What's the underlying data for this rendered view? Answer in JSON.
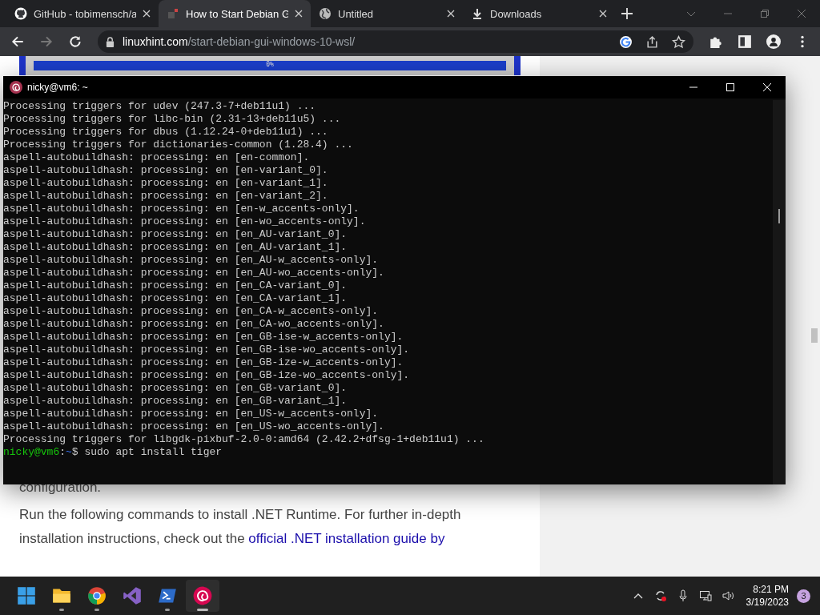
{
  "browser": {
    "tabs": [
      {
        "label": "GitHub - tobimensch/a",
        "selected": false
      },
      {
        "label": "How to Start Debian G",
        "selected": true
      },
      {
        "label": "Untitled",
        "selected": false
      },
      {
        "label": "Downloads",
        "selected": false
      }
    ],
    "address": {
      "domain": "linuxhint.com",
      "path": "/start-debian-gui-windows-10-wsl/"
    }
  },
  "page": {
    "progress_label": "0%",
    "progress": {
      "level": 0
    },
    "cut_line": "configuration.",
    "paragraph": {
      "text": "Run the following commands to install .NET Runtime. For further in-depth installation instructions, check out the ",
      "link": "official .NET installation guide by"
    }
  },
  "terminal": {
    "title": "nicky@vm6: ~",
    "lines": [
      "Processing triggers for udev (247.3-7+deb11u1) ...",
      "Processing triggers for libc-bin (2.31-13+deb11u5) ...",
      "Processing triggers for dbus (1.12.24-0+deb11u1) ...",
      "Processing triggers for dictionaries-common (1.28.4) ...",
      "aspell-autobuildhash: processing: en [en-common].",
      "aspell-autobuildhash: processing: en [en-variant_0].",
      "aspell-autobuildhash: processing: en [en-variant_1].",
      "aspell-autobuildhash: processing: en [en-variant_2].",
      "aspell-autobuildhash: processing: en [en-w_accents-only].",
      "aspell-autobuildhash: processing: en [en-wo_accents-only].",
      "aspell-autobuildhash: processing: en [en_AU-variant_0].",
      "aspell-autobuildhash: processing: en [en_AU-variant_1].",
      "aspell-autobuildhash: processing: en [en_AU-w_accents-only].",
      "aspell-autobuildhash: processing: en [en_AU-wo_accents-only].",
      "aspell-autobuildhash: processing: en [en_CA-variant_0].",
      "aspell-autobuildhash: processing: en [en_CA-variant_1].",
      "aspell-autobuildhash: processing: en [en_CA-w_accents-only].",
      "aspell-autobuildhash: processing: en [en_CA-wo_accents-only].",
      "aspell-autobuildhash: processing: en [en_GB-ise-w_accents-only].",
      "aspell-autobuildhash: processing: en [en_GB-ise-wo_accents-only].",
      "aspell-autobuildhash: processing: en [en_GB-ize-w_accents-only].",
      "aspell-autobuildhash: processing: en [en_GB-ize-wo_accents-only].",
      "aspell-autobuildhash: processing: en [en_GB-variant_0].",
      "aspell-autobuildhash: processing: en [en_GB-variant_1].",
      "aspell-autobuildhash: processing: en [en_US-w_accents-only].",
      "aspell-autobuildhash: processing: en [en_US-wo_accents-only].",
      "Processing triggers for libgdk-pixbuf-2.0-0:amd64 (2.42.2+dfsg-1+deb11u1) ..."
    ],
    "prompt": {
      "user": "nicky@vm6",
      ":": ":",
      "path": "~",
      "symbol": "$",
      "command": " sudo apt install tiger"
    }
  },
  "taskbar": {
    "apps": [
      {
        "selected": false
      },
      {
        "selected": false
      },
      {
        "selected": false
      },
      {
        "selected": false
      },
      {
        "selected": false
      },
      {
        "selected": true
      }
    ],
    "time": "8:21 PM",
    "date": "3/19/2023",
    "badge": "3"
  }
}
